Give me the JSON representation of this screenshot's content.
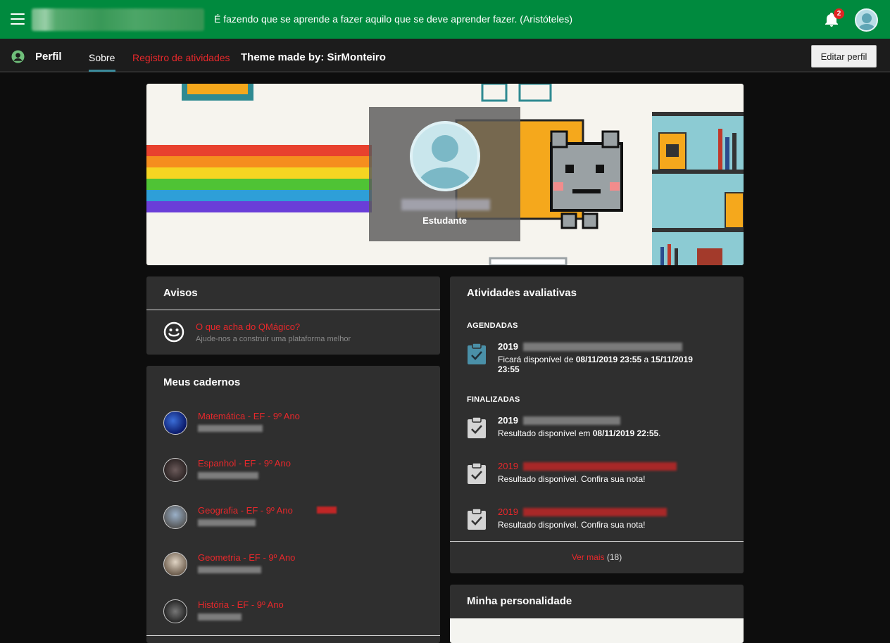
{
  "topbar": {
    "quote": "É fazendo que se aprende a fazer aquilo que se deve aprender fazer. (Aristóteles)",
    "notification_count": "2",
    "accent": "#008a3e"
  },
  "subnav": {
    "title": "Perfil",
    "tabs": [
      {
        "label": "Sobre",
        "active": true
      },
      {
        "label": "Registro de atividades",
        "active": false
      }
    ],
    "theme_credit": "Theme made by: SirMonteiro",
    "edit_button": "Editar perfil"
  },
  "profile": {
    "role": "Estudante"
  },
  "avisos": {
    "title": "Avisos",
    "item_link": "O que acha do QMágico?",
    "item_sub": "Ajude-nos a construir uma plataforma melhor"
  },
  "cadernos": {
    "title": "Meus cadernos",
    "items": [
      {
        "name": "Matemática - EF - 9º Ano"
      },
      {
        "name": "Espanhol - EF - 9º Ano"
      },
      {
        "name": "Geografia - EF - 9º Ano"
      },
      {
        "name": "Geometria - EF - 9º Ano"
      },
      {
        "name": "História - EF - 9º Ano"
      }
    ]
  },
  "atividades": {
    "title": "Atividades avaliativas",
    "agendadas_label": "AGENDADAS",
    "finalizadas_label": "FINALIZADAS",
    "agendadas": [
      {
        "year": "2019",
        "sub_prefix": "Ficará disponível de ",
        "sub_from": "08/11/2019 23:55",
        "sub_mid": " a ",
        "sub_to": "15/11/2019 23:55"
      }
    ],
    "finalizadas": [
      {
        "year": "2019",
        "sub_prefix": "Resultado disponível em ",
        "sub_bold": "08/11/2019 22:55",
        "sub_suffix": "."
      },
      {
        "year": "2019",
        "sub": "Resultado disponível. Confira sua nota!"
      },
      {
        "year": "2019",
        "sub": "Resultado disponível. Confira sua nota!"
      }
    ],
    "ver_mais": "Ver mais",
    "ver_mais_count": "(18)"
  },
  "personalidade": {
    "title": "Minha personalidade"
  },
  "colors": {
    "link_red": "#e8282b",
    "card_bg": "#2f2f2f",
    "page_bg": "#0d0d0d"
  },
  "icons": [
    "menu-icon",
    "bell-icon",
    "user-avatar-icon",
    "person-icon",
    "smiley-icon",
    "clipboard-check-icon"
  ]
}
